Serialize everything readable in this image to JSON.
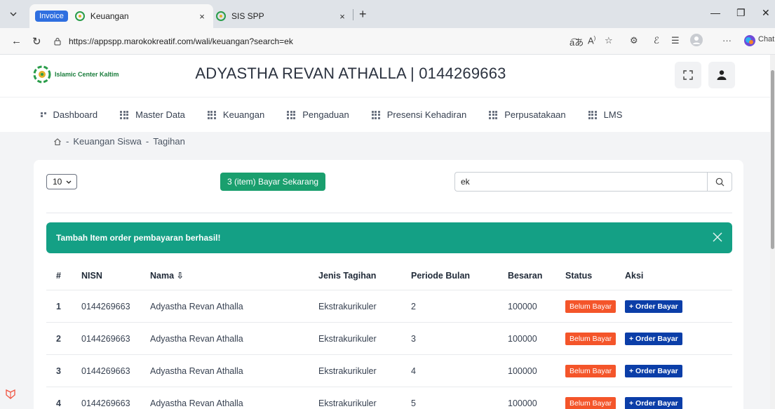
{
  "browser": {
    "tabs": [
      {
        "group_label": "Invoice",
        "title": "Keuangan",
        "close": "×"
      },
      {
        "title": "SIS SPP",
        "close": "×"
      }
    ],
    "new_tab": "+",
    "url": "https://appspp.marokokreatif.com/wali/keuangan?search=ek",
    "chat_label": "Chat",
    "more": "···"
  },
  "header": {
    "school_name": "Islamic Center Kaltim",
    "student_title": "ADYASTHA REVAN ATHALLA | 0144269663"
  },
  "menu": [
    {
      "label": "Dashboard",
      "icon": "dashboard-icon"
    },
    {
      "label": "Master Data",
      "icon": "grid-icon"
    },
    {
      "label": "Keuangan",
      "icon": "grid-icon"
    },
    {
      "label": "Pengaduan",
      "icon": "grid-icon"
    },
    {
      "label": "Presensi Kehadiran",
      "icon": "grid-icon"
    },
    {
      "label": "Perpusatakaan",
      "icon": "grid-icon"
    },
    {
      "label": "LMS",
      "icon": "grid-icon"
    }
  ],
  "breadcrumb": {
    "sep": "-",
    "items": [
      "Keuangan Siswa",
      "Tagihan"
    ]
  },
  "toolbar": {
    "per_page": "10",
    "pay_button": "3 (item) Bayar Sekarang",
    "search_value": "ek"
  },
  "alert": {
    "message": "Tambah Item order pembayaran berhasil!"
  },
  "table": {
    "headers": {
      "no": "#",
      "nisn": "NISN",
      "nama": "Nama ⇩",
      "jenis": "Jenis Tagihan",
      "periode": "Periode Bulan",
      "besaran": "Besaran",
      "status": "Status",
      "aksi": "Aksi"
    },
    "rows": [
      {
        "no": "1",
        "nisn": "0144269663",
        "nama": "Adyastha Revan Athalla",
        "jenis": "Ekstrakurikuler",
        "periode": "2",
        "besaran": "100000",
        "status": "Belum Bayar",
        "aksi": "+ Order Bayar"
      },
      {
        "no": "2",
        "nisn": "0144269663",
        "nama": "Adyastha Revan Athalla",
        "jenis": "Ekstrakurikuler",
        "periode": "3",
        "besaran": "100000",
        "status": "Belum Bayar",
        "aksi": "+ Order Bayar"
      },
      {
        "no": "3",
        "nisn": "0144269663",
        "nama": "Adyastha Revan Athalla",
        "jenis": "Ekstrakurikuler",
        "periode": "4",
        "besaran": "100000",
        "status": "Belum Bayar",
        "aksi": "+ Order Bayar"
      },
      {
        "no": "4",
        "nisn": "0144269663",
        "nama": "Adyastha Revan Athalla",
        "jenis": "Ekstrakurikuler",
        "periode": "5",
        "besaran": "100000",
        "status": "Belum Bayar",
        "aksi": "+ Order Bayar"
      }
    ]
  },
  "colors": {
    "primary_green": "#1a9f6e",
    "alert_teal": "#14a085",
    "status_orange": "#f4552a",
    "order_blue": "#0b3ea8"
  }
}
